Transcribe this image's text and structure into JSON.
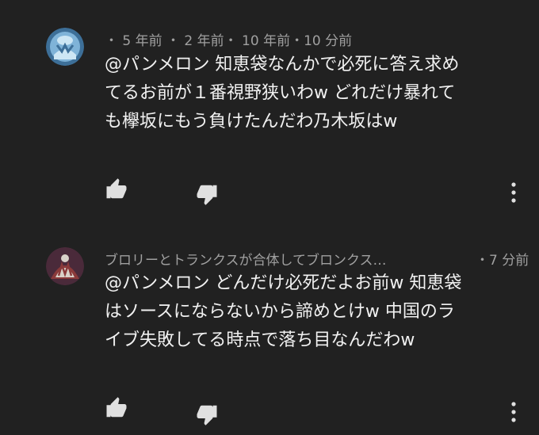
{
  "comments": [
    {
      "meta": "・ 5 年前 ・ 2 年前・ 10 年前・10 分前",
      "lines": [
        "@パンメロン 知恵袋なんかで必死に答え求め",
        "てるお前が１番視野狭いわw どれだけ暴れて",
        "も欅坂にもう負けたんだわ乃木坂はw"
      ],
      "avatar_colors": [
        "#7fb3d8",
        "#3d6f98",
        "#cde6f4"
      ]
    },
    {
      "author": "ブロリーとトランクスが合体してブロンクス…",
      "time": "・7 分前",
      "lines": [
        "@パンメロン どんだけ必死だよお前w 知恵袋",
        "はソースにならないから諦めとけw 中国のラ",
        "イブ失敗してる時点で落ち目なんだわw"
      ],
      "avatar_colors": [
        "#8a3a3a",
        "#d9d2c9",
        "#4a2a3a"
      ]
    }
  ],
  "icons": {
    "like": "thumb-up-icon",
    "dislike": "thumb-down-icon",
    "more": "more-vert-icon"
  },
  "colors": {
    "background": "#212121",
    "text": "#f1f1f1",
    "meta": "#a0a0a0",
    "icon": "#e0e0e0"
  }
}
